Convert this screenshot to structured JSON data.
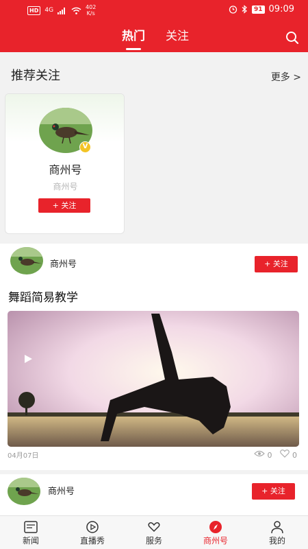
{
  "status": {
    "hd": "HD",
    "signal": "4G",
    "net_speed": "402",
    "net_unit": "K/s",
    "battery": "91",
    "time": "09:09"
  },
  "header": {
    "tabs": [
      {
        "label": "热门",
        "active": true
      },
      {
        "label": "关注",
        "active": false
      }
    ],
    "search_icon": "search-icon"
  },
  "recommend": {
    "title": "推荐关注",
    "more": "更多 >",
    "cards": [
      {
        "name": "商州号",
        "subtitle": "商州号",
        "badge": "V",
        "follow_label": "+ 关注"
      }
    ]
  },
  "feed": {
    "posts": [
      {
        "author": "商州号",
        "follow_label": "+ 关注",
        "title": "舞蹈简易教学",
        "date": "04月07日",
        "views": "0",
        "likes": "0"
      }
    ],
    "next_author": {
      "author": "商州号",
      "follow_label": "+ 关注"
    }
  },
  "bottom_nav": [
    {
      "label": "新闻",
      "icon": "news-icon",
      "active": false
    },
    {
      "label": "直播秀",
      "icon": "live-icon",
      "active": false
    },
    {
      "label": "服务",
      "icon": "service-icon",
      "active": false
    },
    {
      "label": "商州号",
      "icon": "compass-icon",
      "active": true
    },
    {
      "label": "我的",
      "icon": "profile-icon",
      "active": false
    }
  ],
  "colors": {
    "accent": "#e8232b",
    "badge": "#f3c424"
  }
}
